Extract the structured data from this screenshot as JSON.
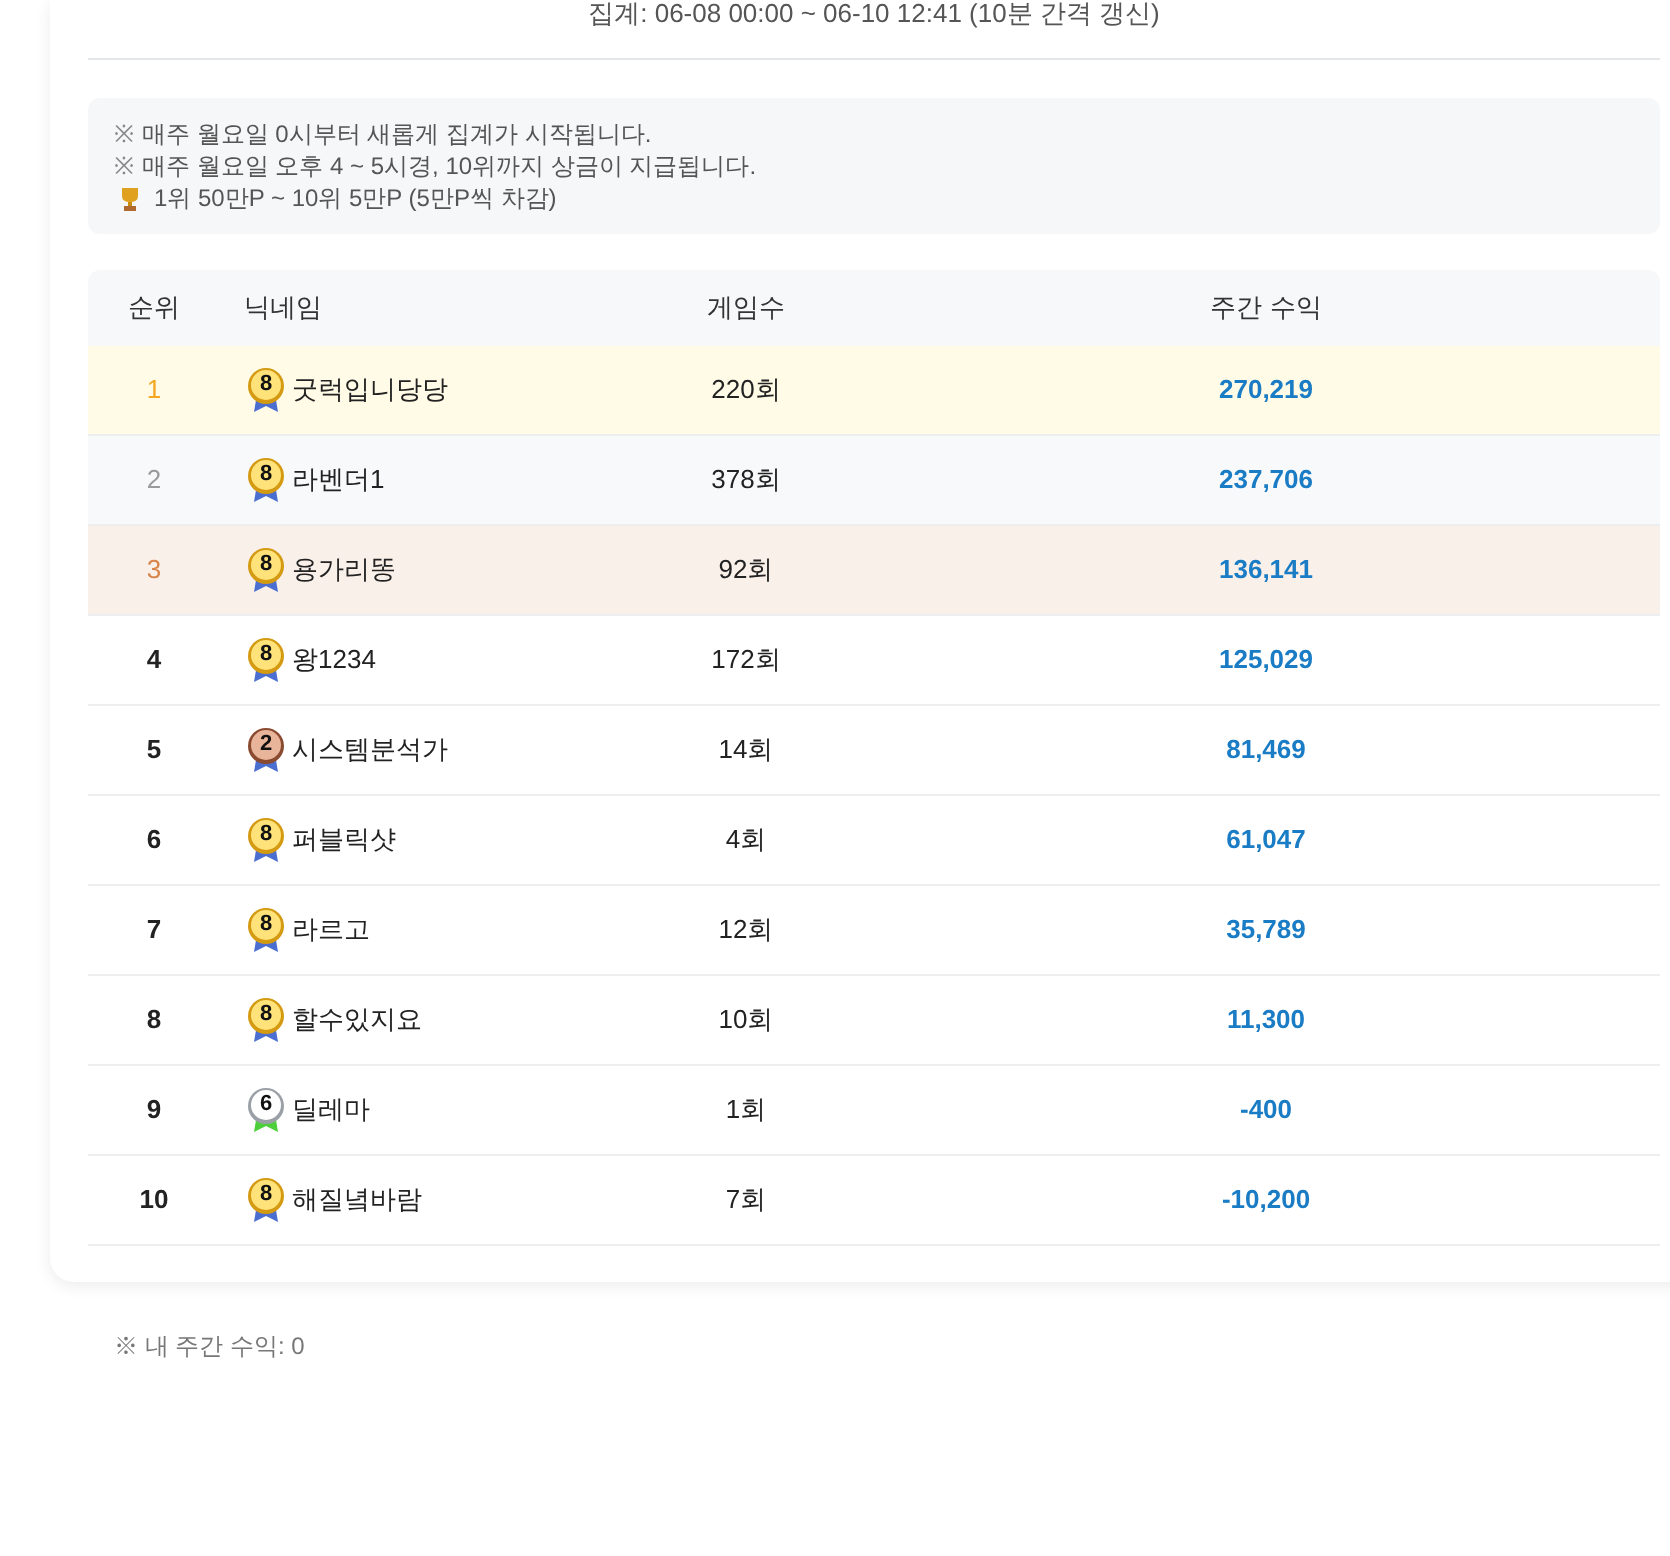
{
  "period": "집계: 06-08 00:00 ~ 06-10 12:41 (10분 간격 갱신)",
  "notices": [
    {
      "kind": "note",
      "mark": "※",
      "text": "매주 월요일 0시부터 새롭게 집계가 시작됩니다."
    },
    {
      "kind": "note",
      "mark": "※",
      "text": "매주 월요일 오후 4 ~ 5시경, 10위까지 상금이 지급됩니다."
    },
    {
      "kind": "trophy",
      "text": "1위 50만P ~ 10위 5만P (5만P씩 차감)"
    }
  ],
  "table": {
    "columns": [
      "순위",
      "닉네임",
      "게임수",
      "주간 수익"
    ],
    "rows": [
      {
        "rank": "1",
        "kind": "gold",
        "badge": {
          "kind": "gold",
          "level": "8"
        },
        "nickname": "굿럭입니당당",
        "games": "220회",
        "income": "270,219"
      },
      {
        "rank": "2",
        "kind": "silver",
        "badge": {
          "kind": "gold",
          "level": "8"
        },
        "nickname": "라벤더1",
        "games": "378회",
        "income": "237,706"
      },
      {
        "rank": "3",
        "kind": "bronze",
        "badge": {
          "kind": "gold",
          "level": "8"
        },
        "nickname": "용가리똥",
        "games": "92회",
        "income": "136,141"
      },
      {
        "rank": "4",
        "kind": "plain",
        "badge": {
          "kind": "gold",
          "level": "8"
        },
        "nickname": "왕1234",
        "games": "172회",
        "income": "125,029"
      },
      {
        "rank": "5",
        "kind": "plain",
        "badge": {
          "kind": "bronze",
          "level": "2"
        },
        "nickname": "시스템분석가",
        "games": "14회",
        "income": "81,469"
      },
      {
        "rank": "6",
        "kind": "plain",
        "badge": {
          "kind": "gold",
          "level": "8"
        },
        "nickname": "퍼블릭샷",
        "games": "4회",
        "income": "61,047"
      },
      {
        "rank": "7",
        "kind": "plain",
        "badge": {
          "kind": "gold",
          "level": "8"
        },
        "nickname": "라르고",
        "games": "12회",
        "income": "35,789"
      },
      {
        "rank": "8",
        "kind": "plain",
        "badge": {
          "kind": "gold",
          "level": "8"
        },
        "nickname": "할수있지요",
        "games": "10회",
        "income": "11,300"
      },
      {
        "rank": "9",
        "kind": "plain",
        "badge": {
          "kind": "silver",
          "level": "6"
        },
        "nickname": "딜레마",
        "games": "1회",
        "income": "-400"
      },
      {
        "rank": "10",
        "kind": "plain",
        "badge": {
          "kind": "gold",
          "level": "8"
        },
        "nickname": "해질녘바람",
        "games": "7회",
        "income": "-10,200"
      }
    ]
  },
  "footer": "※ 내 주간 수익: 0"
}
